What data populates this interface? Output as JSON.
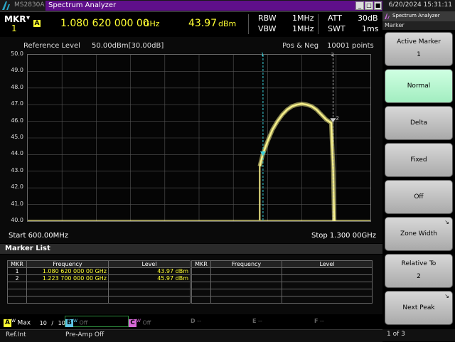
{
  "window": {
    "model": "MS2830A",
    "app_title": "Spectrum Analyzer",
    "datetime": "6/20/2024 15:31:11",
    "minimize_glyph": "_",
    "restore_glyph": "□",
    "maximize_glyph": "■"
  },
  "header": {
    "mkr_label": "MKR",
    "mkr_dropdown": "▾",
    "mkr_number": "1",
    "trace_badge": "A",
    "frequency": "1.080 620 000 00",
    "frequency_unit": "GHz",
    "level": "43.97",
    "level_unit": "dBm",
    "rbw_label": "RBW",
    "rbw_value": "1MHz",
    "vbw_label": "VBW",
    "vbw_value": "1MHz",
    "att_label": "ATT",
    "att_value": "30dB",
    "swt_label": "SWT",
    "swt_value": "1ms"
  },
  "graph": {
    "reference_level_label": "Reference Level",
    "reference_level_value": "50.00dBm[30.00dB]",
    "detector": "Pos & Neg",
    "points": "10001 points",
    "start": "Start 600.00MHz",
    "stop": "Stop 1.300 00GHz",
    "y_ticks": [
      "50.0",
      "49.0",
      "48.0",
      "47.0",
      "46.0",
      "45.0",
      "44.0",
      "43.0",
      "42.0",
      "41.0",
      "40.0"
    ],
    "marker1_flag": "1",
    "marker2_flag": "2",
    "trace_color": "#f6f08a",
    "marker1_color": "#3cd0d8"
  },
  "chart_data": {
    "type": "line",
    "title": "",
    "xlabel": "",
    "ylabel": "",
    "x_range_ghz": [
      0.6,
      1.3
    ],
    "ylim": [
      40.0,
      50.0
    ],
    "grid": true,
    "noise_floor_dbm": 40.0,
    "x": [
      1.074,
      1.08,
      1.09,
      1.1,
      1.11,
      1.12,
      1.13,
      1.14,
      1.15,
      1.16,
      1.17,
      1.18,
      1.19,
      1.2,
      1.21,
      1.22,
      1.224,
      1.226
    ],
    "y": [
      43.3,
      44.0,
      44.8,
      45.5,
      46.0,
      46.4,
      46.7,
      46.9,
      47.0,
      47.05,
      47.0,
      46.9,
      46.7,
      46.4,
      46.1,
      45.9,
      43.0,
      40.0
    ],
    "markers": [
      {
        "id": "1",
        "freq_ghz": 1.08062,
        "level_dbm": 43.97
      },
      {
        "id": "2",
        "freq_ghz": 1.2237,
        "level_dbm": 45.97
      }
    ]
  },
  "marker_list": {
    "title": "Marker List",
    "headers": [
      "MKR",
      "Frequency",
      "Level"
    ],
    "rows": [
      {
        "mkr": "1",
        "frequency": "1.080 620 000 00 GHz",
        "level": "43.97 dBm"
      },
      {
        "mkr": "2",
        "frequency": "1.223 700 000 00 GHz",
        "level": "45.97 dBm"
      }
    ]
  },
  "tracebar": {
    "a_letter": "A",
    "a_superscript": "W",
    "a_mode": "Max",
    "a_count": "10",
    "a_slash": "/",
    "a_total": "10",
    "b_letter": "B",
    "b_superscript": "W",
    "b_state": "Off",
    "c_letter": "C",
    "c_superscript": "W",
    "c_state": "Off",
    "d_letter": "D",
    "d_state": "--",
    "e_letter": "E",
    "e_state": "--",
    "f_letter": "F",
    "f_state": "--"
  },
  "status": {
    "ref": "Ref.Int",
    "preamp": "Pre-Amp Off"
  },
  "right_panel": {
    "title": "Spectrum Analyzer",
    "subtitle": "Marker",
    "softkeys": [
      {
        "label": "Active Marker",
        "value": "1",
        "corner": ""
      },
      {
        "label": "Normal",
        "value": "",
        "corner": ""
      },
      {
        "label": "Delta",
        "value": "",
        "corner": ""
      },
      {
        "label": "Fixed",
        "value": "",
        "corner": ""
      },
      {
        "label": "Off",
        "value": "",
        "corner": ""
      },
      {
        "label": "Zone Width",
        "value": "",
        "corner": "↘"
      },
      {
        "label": "Relative To",
        "value": "2",
        "corner": ""
      },
      {
        "label": "Next Peak",
        "value": "",
        "corner": "↘"
      }
    ],
    "page": "1 of 3"
  }
}
